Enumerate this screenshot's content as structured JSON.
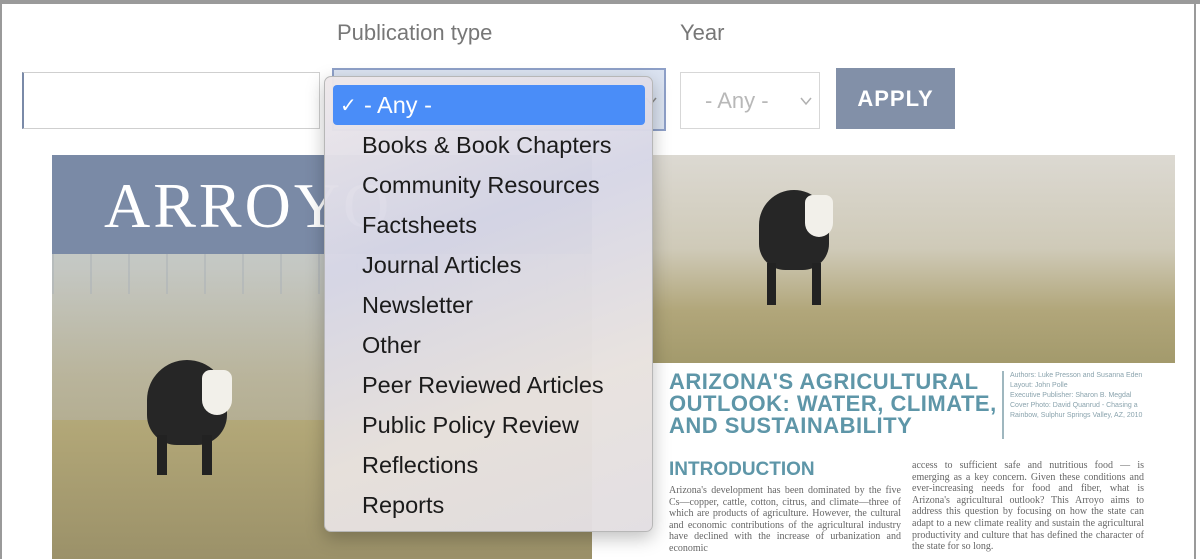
{
  "filters": {
    "publication_type_label": "Publication type",
    "year_label": "Year",
    "search_value": "",
    "year_value": "- Any -",
    "apply_label": "APPLY"
  },
  "publication_type_menu": {
    "selected_index": 0,
    "items": [
      "- Any -",
      "Books & Book Chapters",
      "Community Resources",
      "Factsheets",
      "Journal Articles",
      "Newsletter",
      "Other",
      "Peer Reviewed Articles",
      "Public Policy Review",
      "Reflections",
      "Reports"
    ]
  },
  "preview": {
    "masthead": "ARROYO",
    "article_title": "ARIZONA'S AGRICULTURAL OUTLOOK: WATER, CLIMATE, AND SUSTAINABILITY",
    "credits": [
      "Authors: Luke Presson and Susanna Eden",
      "Layout: John Polle",
      "Executive Publisher: Sharon B. Megdal",
      "Cover Photo: David Quanrud - Chasing a",
      "Rainbow, Sulphur Springs Valley, AZ, 2010"
    ],
    "intro_heading": "INTRODUCTION",
    "body_left": "Arizona's development has been dominated by the five Cs—copper, cattle, cotton, citrus, and climate—three of which are products of agriculture. However, the cultural and economic contributions of the agricultural industry have declined with the increase of urbanization and economic",
    "body_right": "access to sufficient safe and nutritious food — is emerging as a key concern. Given these conditions and ever-increasing needs for food and fiber, what is Arizona's agricultural outlook? This Arroyo aims to address this question by focusing on how the state can adapt to a new climate reality and sustain the agricultural productivity and culture that has defined the character of the state for so long."
  },
  "colors": {
    "accent": "#4a8df8",
    "apply_button": "#8290a8",
    "masthead": "#7a8aa6",
    "title_teal": "#5e96a8"
  }
}
